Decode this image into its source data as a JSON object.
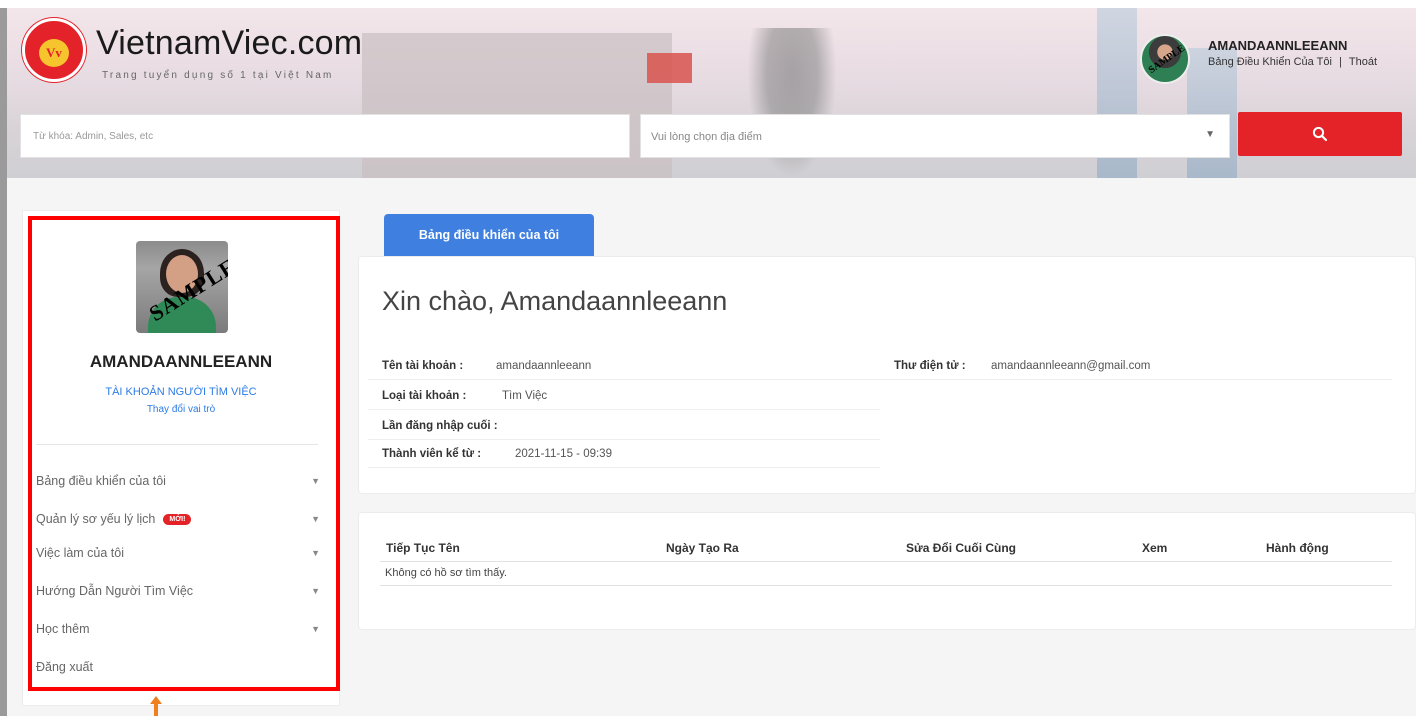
{
  "brand": {
    "logo_mark": "Vv",
    "name": "VietnamViec.com",
    "tagline": "Trang tuyển dụng số 1 tại Việt Nam"
  },
  "user": {
    "name": "AMANDAANNLEEANN",
    "dashboard_link": "Bảng Điều Khiển Của Tôi",
    "separator": "|",
    "logout_link": "Thoát",
    "avatar_watermark": "SAMPLE"
  },
  "search": {
    "keyword_placeholder": "Từ khóa: Admin, Sales, etc",
    "location_placeholder": "Vui lòng chọn địa điểm",
    "button_icon": "search-icon",
    "button_color": "#e42328"
  },
  "sidebar": {
    "photo_watermark": "SAMPLE",
    "profile_name": "AMANDAANNLEEANN",
    "account_type": "TÀI KHOẢN NGƯỜI TÌM VIỆC",
    "change_role": "Thay đổi vai trò",
    "menu": [
      {
        "label": "Bảng điều khiển của tôi",
        "has_dropdown": true
      },
      {
        "label": "Quản lý sơ yếu lý lịch",
        "badge": "MỚI!",
        "has_dropdown": true
      },
      {
        "label": "Việc làm của tôi",
        "has_dropdown": true
      },
      {
        "label": "Hướng Dẫn Người Tìm Việc",
        "has_dropdown": true
      },
      {
        "label": "Học thêm",
        "has_dropdown": true
      },
      {
        "label": "Đăng xuất",
        "has_dropdown": false
      }
    ],
    "highlight_color": "#ff0000"
  },
  "main": {
    "active_tab": "Bảng điều khiển của tôi",
    "greeting": "Xin chào, Amandaannleeann",
    "account_info": {
      "username_label": "Tên tài khoản :",
      "username_value": "amandaannleeann",
      "email_label": "Thư điện tử :",
      "email_value": "amandaannleeann@gmail.com",
      "type_label": "Loại tài khoản :",
      "type_value": "Tìm Việc",
      "last_login_label": "Lần đăng nhập cuối :",
      "last_login_value": "",
      "member_since_label": "Thành viên kể từ :",
      "member_since_value": "2021-11-15 - 09:39"
    },
    "resume_table": {
      "columns": [
        "Tiếp Tục Tên",
        "Ngày Tạo Ra",
        "Sửa Đổi Cuối Cùng",
        "Xem",
        "Hành động"
      ],
      "empty_message": "Không có hồ sơ tìm thấy."
    }
  },
  "colors": {
    "accent_blue": "#3f7fe0",
    "brand_red": "#e42328",
    "annotation_arrow": "#f07f1e"
  }
}
